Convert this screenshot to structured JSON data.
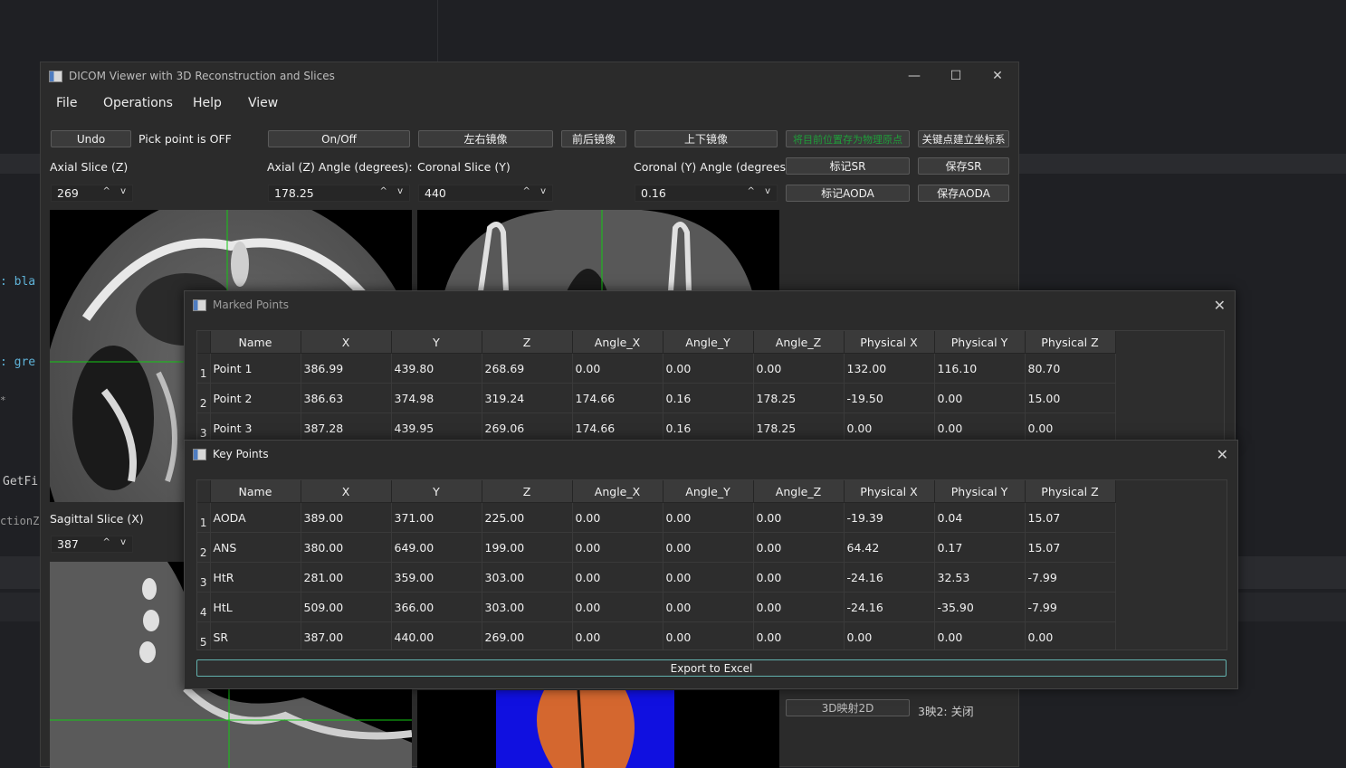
{
  "background": {
    "code_fragments": [
      ": bla",
      ": gre",
      "*",
      "GetFi",
      "ctionZ:"
    ]
  },
  "main_window": {
    "title": "DICOM Viewer with 3D Reconstruction and Slices",
    "controls": {
      "minimize": "—",
      "maximize": "☐",
      "close": "✕"
    },
    "menu": [
      "File",
      "Operations",
      "Help",
      "View"
    ],
    "undo_label": "Undo",
    "pick_status": "Pick point is OFF",
    "onoff_label": "On/Off",
    "mirror_lr": "左右镜像",
    "mirror_fb": "前后镜像",
    "mirror_ud": "上下镜像",
    "save_physical_origin": "将目前位置存为物理原点",
    "build_coordinate": "关键点建立坐标系",
    "axial_slice_label": "Axial Slice (Z)",
    "axial_angle_label": "Axial (Z) Angle (degrees):",
    "coronal_slice_label": "Coronal Slice (Y)",
    "coronal_angle_label": "Coronal (Y) Angle (degrees):",
    "mark_sr": "标记SR",
    "save_sr": "保存SR",
    "mark_aoda": "标记AODA",
    "save_aoda": "保存AODA",
    "axial_slice_value": "269",
    "axial_angle_value": "178.25",
    "coronal_slice_value": "440",
    "coronal_angle_value": "0.16",
    "sagittal_slice_label": "Sagittal Slice (X)",
    "sagittal_slice_value": "387",
    "map3d2d": "3D映射2D",
    "map_status": "3映2: 关闭",
    "spin_arrows": "^ v",
    "save_origin_color": "#1f9e3a"
  },
  "marked_points": {
    "title": "Marked Points",
    "close": "✕",
    "columns": [
      "Name",
      "X",
      "Y",
      "Z",
      "Angle_X",
      "Angle_Y",
      "Angle_Z",
      "Physical X",
      "Physical Y",
      "Physical Z"
    ],
    "rows": [
      {
        "n": "1",
        "cells": [
          "Point 1",
          "386.99",
          "439.80",
          "268.69",
          "0.00",
          "0.00",
          "0.00",
          "132.00",
          "116.10",
          "80.70"
        ]
      },
      {
        "n": "2",
        "cells": [
          "Point 2",
          "386.63",
          "374.98",
          "319.24",
          "174.66",
          "0.16",
          "178.25",
          "-19.50",
          "0.00",
          "15.00"
        ]
      },
      {
        "n": "3",
        "cells": [
          "Point 3",
          "387.28",
          "439.95",
          "269.06",
          "174.66",
          "0.16",
          "178.25",
          "0.00",
          "0.00",
          "0.00"
        ]
      }
    ]
  },
  "key_points": {
    "title": "Key Points",
    "close": "✕",
    "columns": [
      "Name",
      "X",
      "Y",
      "Z",
      "Angle_X",
      "Angle_Y",
      "Angle_Z",
      "Physical X",
      "Physical Y",
      "Physical Z"
    ],
    "rows": [
      {
        "n": "1",
        "cells": [
          "AODA",
          "389.00",
          "371.00",
          "225.00",
          "0.00",
          "0.00",
          "0.00",
          "-19.39",
          "0.04",
          "15.07"
        ]
      },
      {
        "n": "2",
        "cells": [
          "ANS",
          "380.00",
          "649.00",
          "199.00",
          "0.00",
          "0.00",
          "0.00",
          "64.42",
          "0.17",
          "15.07"
        ]
      },
      {
        "n": "3",
        "cells": [
          "HtR",
          "281.00",
          "359.00",
          "303.00",
          "0.00",
          "0.00",
          "0.00",
          "-24.16",
          "32.53",
          "-7.99"
        ]
      },
      {
        "n": "4",
        "cells": [
          "HtL",
          "509.00",
          "366.00",
          "303.00",
          "0.00",
          "0.00",
          "0.00",
          "-24.16",
          "-35.90",
          "-7.99"
        ]
      },
      {
        "n": "5",
        "cells": [
          "SR",
          "387.00",
          "440.00",
          "269.00",
          "0.00",
          "0.00",
          "0.00",
          "0.00",
          "0.00",
          "0.00"
        ]
      }
    ],
    "export_label": "Export to Excel"
  }
}
